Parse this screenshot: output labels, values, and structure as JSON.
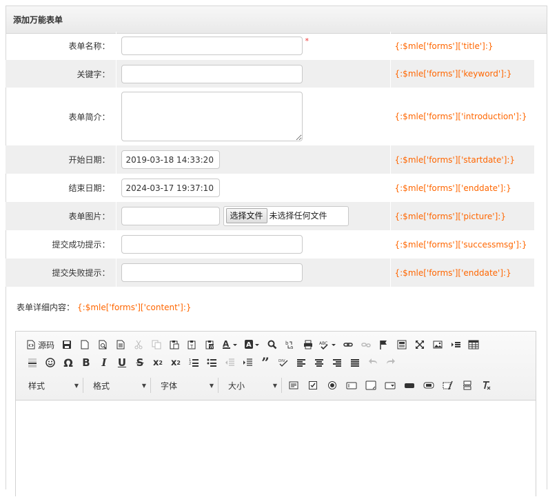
{
  "panel": {
    "title": "添加万能表单"
  },
  "form": {
    "rows": [
      {
        "label": "表单名称：",
        "value": "",
        "required": "*",
        "tip": "{:$mle['forms']['title']:}"
      },
      {
        "label": "关键字：",
        "value": "",
        "tip": "{:$mle['forms']['keyword']:}"
      },
      {
        "label": "表单简介：",
        "value": "",
        "tip": "{:$mle['forms']['introduction']:}"
      },
      {
        "label": "开始日期：",
        "value": "2019-03-18 14:33:20",
        "tip": "{:$mle['forms']['startdate']:}"
      },
      {
        "label": "结束日期：",
        "value": "2024-03-17 19:37:10",
        "tip": "{:$mle['forms']['enddate']:}"
      },
      {
        "label": "表单图片：",
        "value": "",
        "file_button": "选择文件",
        "file_status": "未选择任何文件",
        "tip": "{:$mle['forms']['picture']:}"
      },
      {
        "label": "提交成功提示：",
        "value": "",
        "tip": "{:$mle['forms']['successmsg']:}"
      },
      {
        "label": "提交失败提示：",
        "value": "",
        "tip": "{:$mle['forms']['enddate']:}"
      }
    ]
  },
  "content": {
    "label": "表单详细内容：",
    "tip": "{:$mle['forms']['content']:}"
  },
  "editor": {
    "source_label": "源码",
    "combos": [
      "样式",
      "格式",
      "字体",
      "大小"
    ],
    "body": ""
  },
  "colors": {
    "tip": "#ff6600",
    "required": "#ee3333",
    "shade": "#efefef"
  }
}
